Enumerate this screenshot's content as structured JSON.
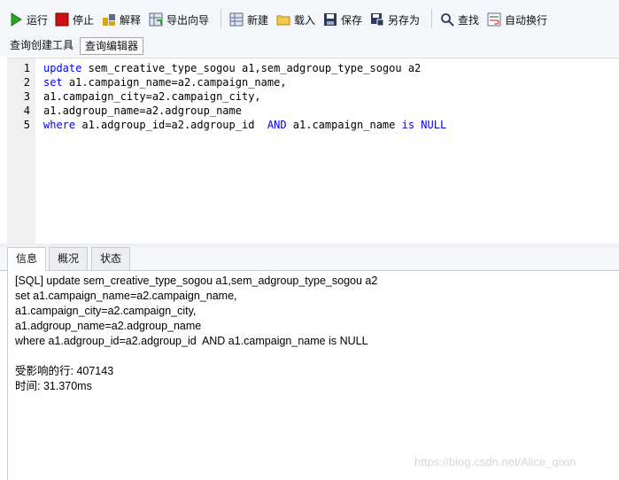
{
  "toolbar": {
    "run": "运行",
    "stop": "停止",
    "explain": "解释",
    "export_wizard": "导出向导",
    "new": "新建",
    "load": "载入",
    "save": "保存",
    "save_as": "另存为",
    "find": "查找",
    "word_wrap": "自动换行"
  },
  "subtabs": [
    "查询创建工具",
    "查询编辑器"
  ],
  "editor": {
    "line_numbers": [
      "1",
      "2",
      "3",
      "4",
      "5"
    ],
    "lines": [
      {
        "kw": "update",
        "text": " sem_creative_type_sogou a1,sem_adgroup_type_sogou a2"
      },
      {
        "kw": "set",
        "text": " a1.campaign_name=a2.campaign_name,"
      },
      {
        "kw": "",
        "text": "a1.campaign_city=a2.campaign_city,"
      },
      {
        "kw": "",
        "text": "a1.adgroup_name=a2.adgroup_name"
      },
      {
        "kw": "where",
        "text": " a1.adgroup_id=a2.adgroup_id  ",
        "kw2": "AND",
        "text2": " a1.campaign_name ",
        "kw3": "is",
        "text3": " ",
        "kw4": "NULL"
      }
    ]
  },
  "result_tabs": [
    "信息",
    "概况",
    "状态"
  ],
  "output": {
    "lines": [
      "[SQL] update sem_creative_type_sogou a1,sem_adgroup_type_sogou a2",
      "set a1.campaign_name=a2.campaign_name,",
      "a1.campaign_city=a2.campaign_city,",
      "a1.adgroup_name=a2.adgroup_name",
      "where a1.adgroup_id=a2.adgroup_id  AND a1.campaign_name is NULL",
      "",
      "受影响的行: 407143",
      "时间: 31.370ms"
    ]
  },
  "watermark": "https://blog.csdn.net/Alice_qixin",
  "colors": {
    "keyword": "#0000ff",
    "run_icon": "#2aa52a",
    "stop_icon": "#cc1111"
  },
  "icons": [
    "run-icon",
    "stop-icon",
    "explain-icon",
    "export-wizard-icon",
    "new-icon",
    "load-icon",
    "save-icon",
    "save-as-icon",
    "find-icon",
    "word-wrap-icon"
  ]
}
